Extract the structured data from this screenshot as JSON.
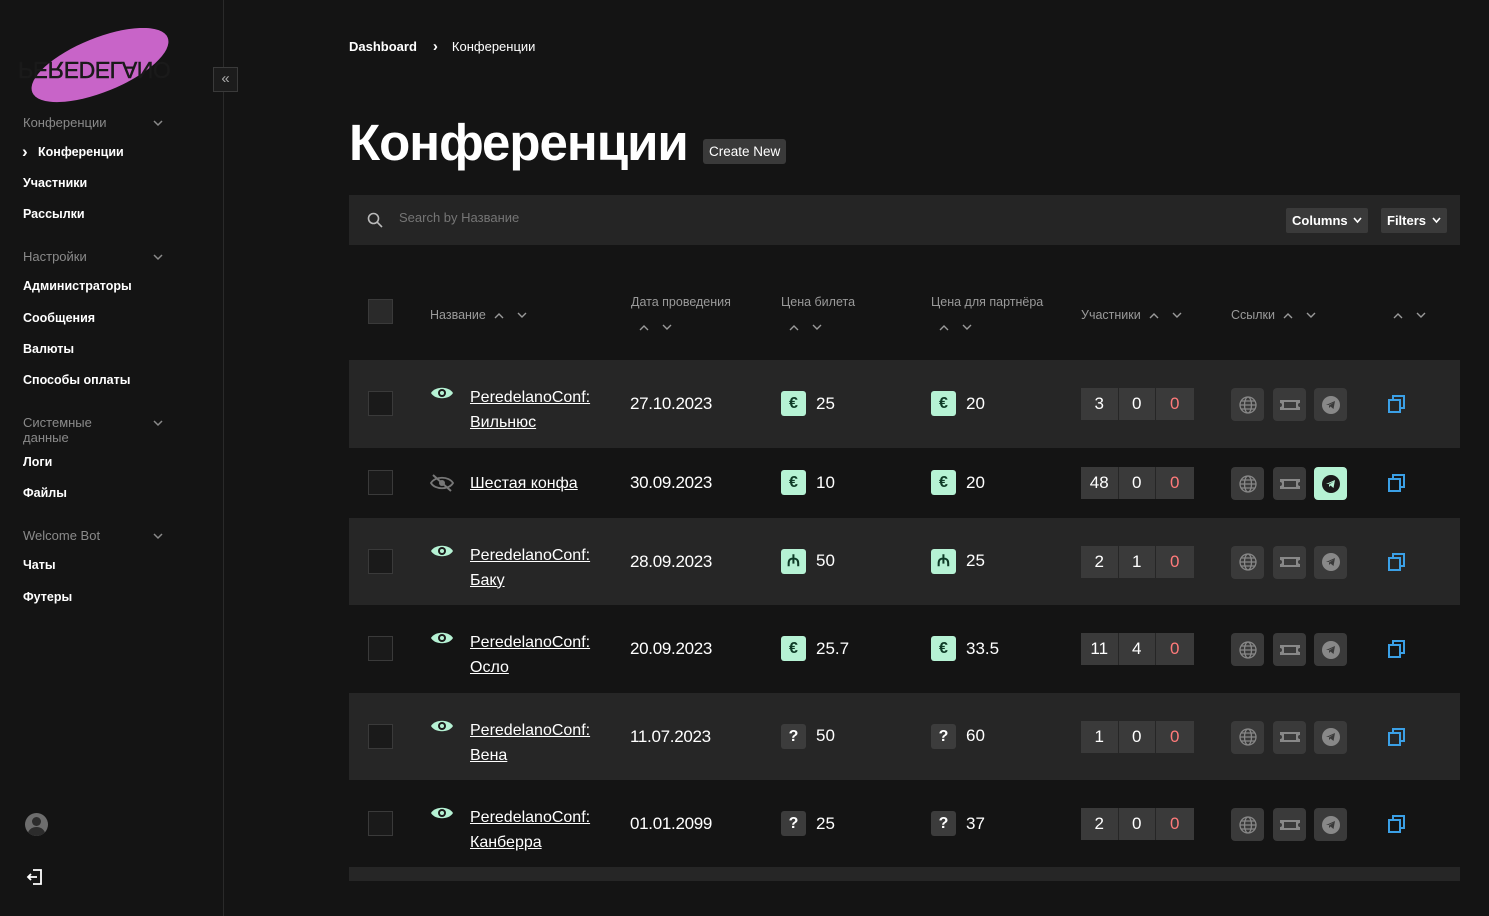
{
  "app": {
    "logo_text": "PEREDELANO"
  },
  "sidebar": {
    "collapse_label": "«",
    "groups": [
      {
        "label": "Конференции",
        "items": [
          "Конференции",
          "Участники",
          "Рассылки"
        ]
      },
      {
        "label": "Настройки",
        "items": [
          "Администраторы",
          "Сообщения",
          "Валюты",
          "Способы оплаты"
        ]
      },
      {
        "label": "Системные данные",
        "items": [
          "Логи",
          "Файлы"
        ]
      },
      {
        "label": "Welcome Bot",
        "items": [
          "Чаты",
          "Футеры"
        ]
      }
    ],
    "active_item": "Конференции"
  },
  "breadcrumb": {
    "home": "Dashboard",
    "current": "Конференции"
  },
  "page": {
    "title": "Конференции",
    "create_label": "Create New"
  },
  "toolbar": {
    "search_placeholder": "Search by Название",
    "columns_label": "Columns",
    "filters_label": "Filters"
  },
  "table": {
    "columns": [
      "Название",
      "Дата проведения",
      "Цена билета",
      "Цена для партнёра",
      "Участники",
      "Ссылки"
    ],
    "rows": [
      {
        "visible": true,
        "name": "PeredelanoConf: Вильнюс",
        "date": "27.10.2023",
        "ticket_cur": "€",
        "ticket": "25",
        "partner_cur": "€",
        "partner": "20",
        "participants": [
          "3",
          "0",
          "0"
        ],
        "telegram_active": false
      },
      {
        "visible": false,
        "name": "Шестая конфа",
        "date": "30.09.2023",
        "ticket_cur": "€",
        "ticket": "10",
        "partner_cur": "€",
        "partner": "20",
        "participants": [
          "48",
          "0",
          "0"
        ],
        "telegram_active": true
      },
      {
        "visible": true,
        "name": "PeredelanoConf: Баку",
        "date": "28.09.2023",
        "ticket_cur": "₼",
        "ticket": "50",
        "partner_cur": "₼",
        "partner": "25",
        "participants": [
          "2",
          "1",
          "0"
        ],
        "telegram_active": false
      },
      {
        "visible": true,
        "name": "PeredelanoConf: Осло",
        "date": "20.09.2023",
        "ticket_cur": "€",
        "ticket": "25.7",
        "partner_cur": "€",
        "partner": "33.5",
        "participants": [
          "11",
          "4",
          "0"
        ],
        "telegram_active": false
      },
      {
        "visible": true,
        "name": "PeredelanoConf: Вена",
        "date": "11.07.2023",
        "ticket_cur": "?",
        "ticket": "50",
        "partner_cur": "?",
        "partner": "60",
        "participants": [
          "1",
          "0",
          "0"
        ],
        "telegram_active": false
      },
      {
        "visible": true,
        "name": "PeredelanoConf: Канберра",
        "date": "01.01.2099",
        "ticket_cur": "?",
        "ticket": "25",
        "partner_cur": "?",
        "partner": "37",
        "participants": [
          "2",
          "0",
          "0"
        ],
        "telegram_active": false
      }
    ]
  },
  "colors": {
    "accent": "#b6f2d4",
    "logo_pink": "#c864c8",
    "danger": "#ff7a7a",
    "copy": "#3ba0e6"
  }
}
